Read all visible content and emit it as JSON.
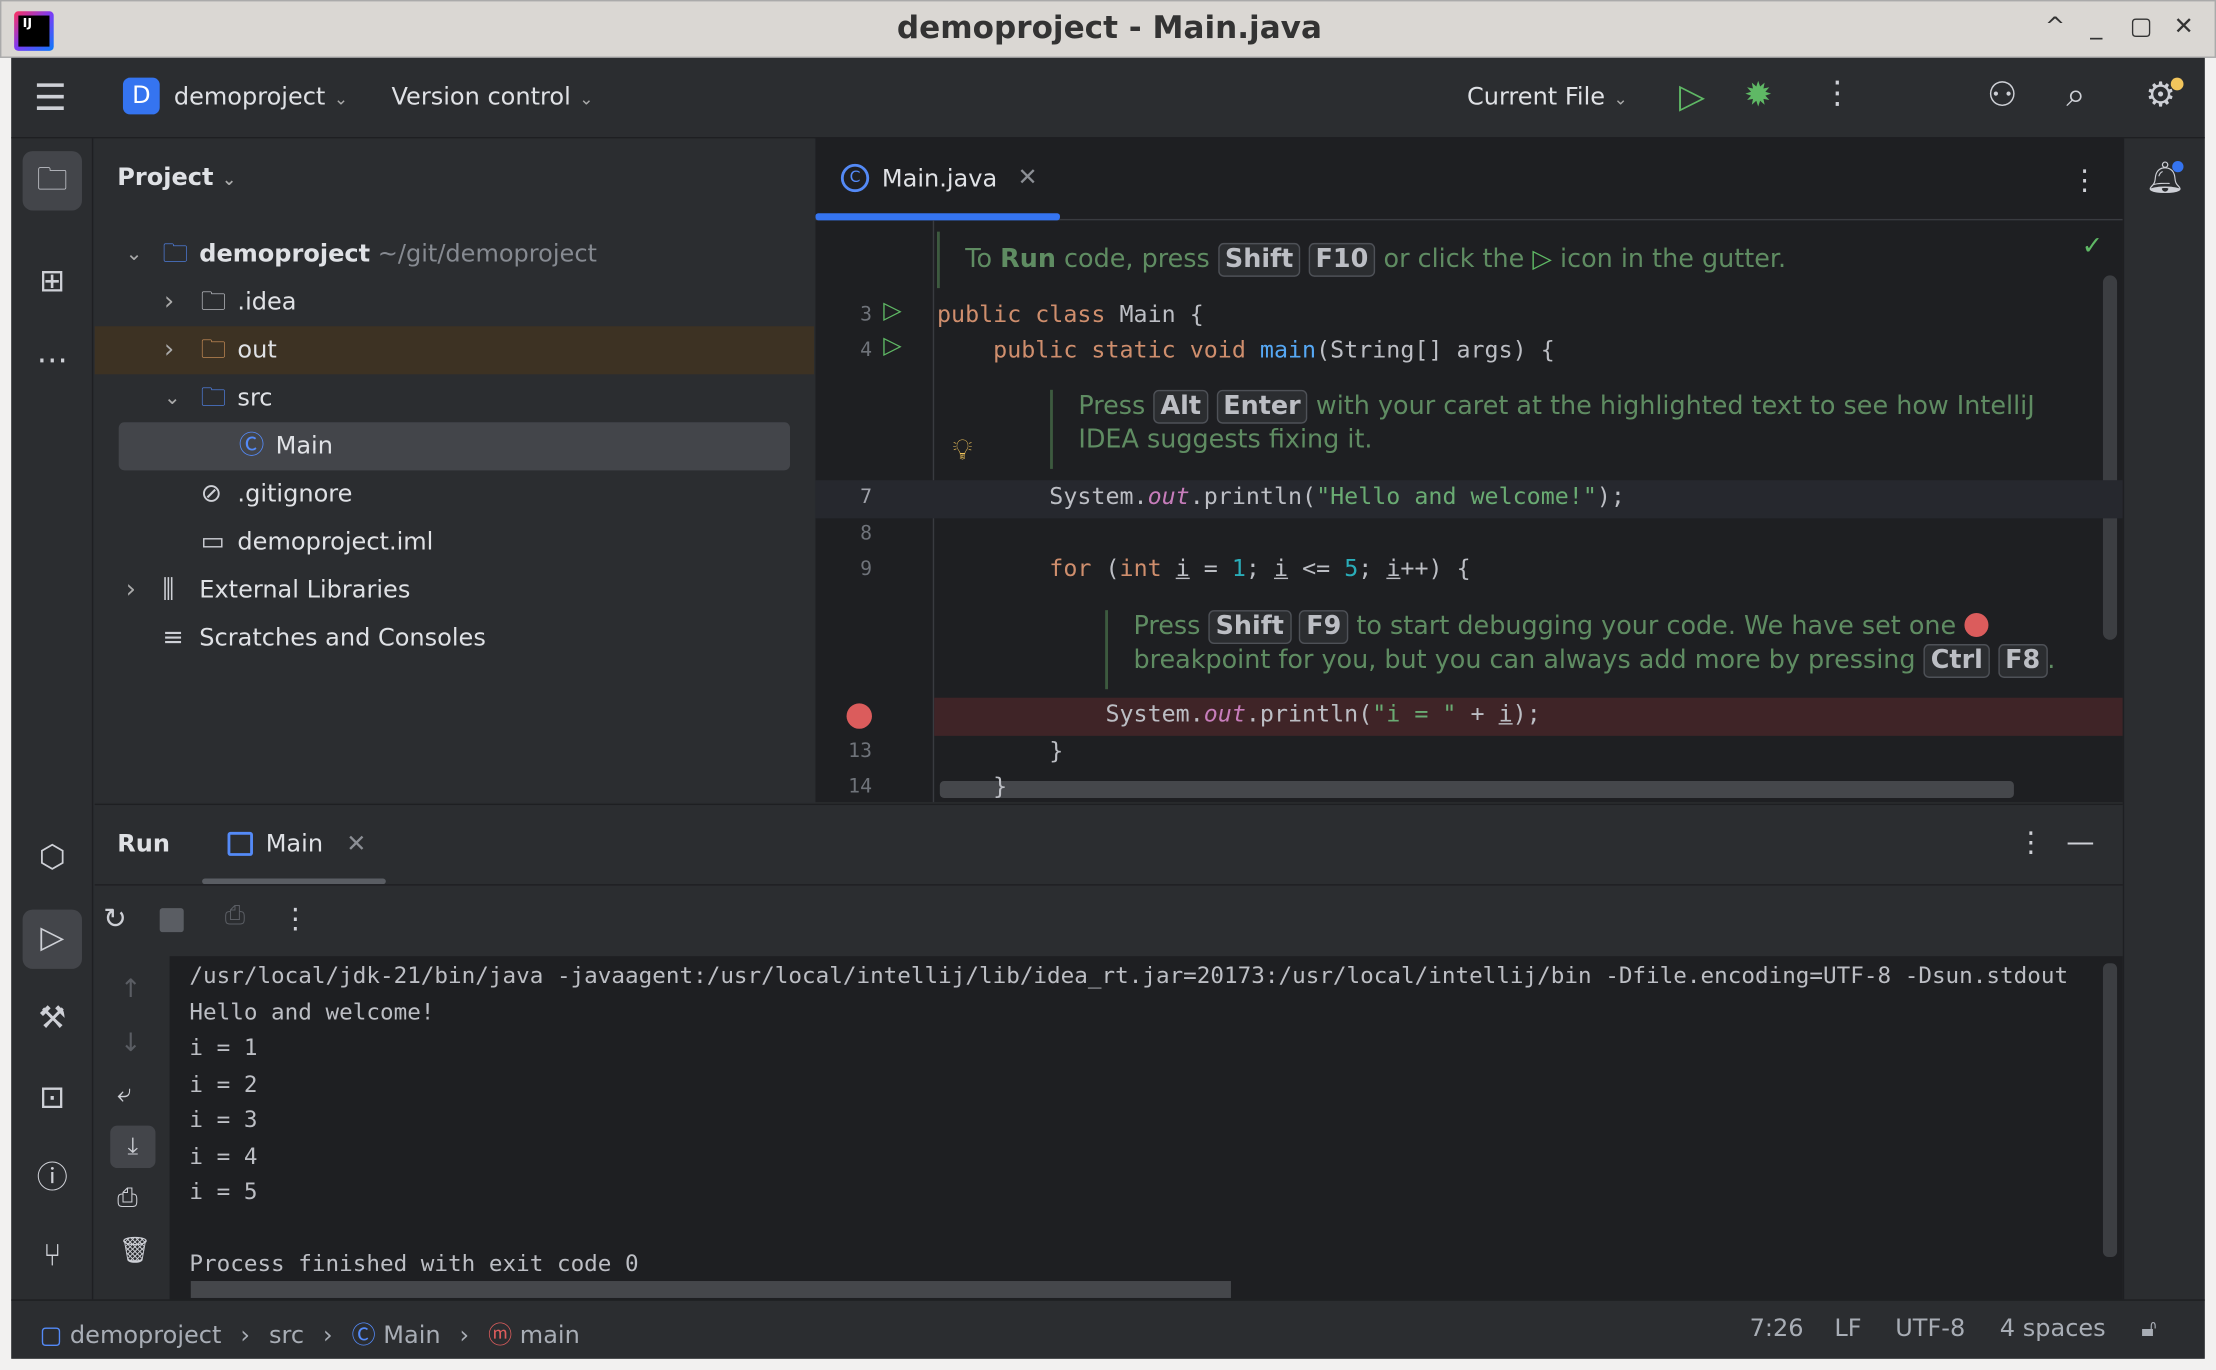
{
  "window": {
    "title": "demoproject - Main.java",
    "controls": [
      "^",
      "_",
      "▢",
      "✕"
    ]
  },
  "toolbar": {
    "project_badge": "D",
    "project": "demoproject",
    "vcs": "Version control",
    "run_config": "Current File"
  },
  "project_panel": {
    "title": "Project",
    "tree": [
      {
        "label": "demoproject",
        "hint": "~/git/demoproject",
        "icon": "module-folder-icon",
        "level": 0,
        "expanded": true,
        "bold": true
      },
      {
        "label": ".idea",
        "icon": "folder-icon",
        "level": 1,
        "expanded": false
      },
      {
        "label": "out",
        "icon": "folder-icon",
        "level": 1,
        "expanded": false,
        "excluded": true
      },
      {
        "label": "src",
        "icon": "source-folder-icon",
        "level": 1,
        "expanded": true
      },
      {
        "label": "Main",
        "icon": "class-icon",
        "level": 2,
        "selected": true
      },
      {
        "label": ".gitignore",
        "icon": "ignore-file-icon",
        "level": 1
      },
      {
        "label": "demoproject.iml",
        "icon": "iml-file-icon",
        "level": 1
      },
      {
        "label": "External Libraries",
        "icon": "library-icon",
        "level": 0,
        "expanded": false
      },
      {
        "label": "Scratches and Consoles",
        "icon": "scratches-icon",
        "level": 0
      }
    ]
  },
  "editor": {
    "tab": "Main.java",
    "tip_run": {
      "pre": "To ",
      "bold": "Run",
      "mid": " code, press ",
      "k1": "Shift",
      "k2": "F10",
      "post1": " or click the ",
      "post2": " icon in the gutter."
    },
    "tip_fix": {
      "pre": "Press ",
      "k1": "Alt",
      "k2": "Enter",
      "post": " with your caret at the highlighted text to see how IntelliJ IDEA suggests fixing it."
    },
    "tip_debug": {
      "pre": "Press ",
      "k1": "Shift",
      "k2": "F9",
      "mid": " to start debugging your code. We have set one ",
      "line2": "breakpoint for you, but you can always add more by pressing ",
      "k3": "Ctrl",
      "k4": "F8",
      "end": "."
    },
    "lines": [
      {
        "n": "3",
        "tokens": [
          [
            "kw",
            "public class "
          ],
          [
            "",
            "Main {"
          ]
        ]
      },
      {
        "n": "4",
        "tokens": [
          [
            "kw",
            "    public static void "
          ],
          [
            "fn",
            "main"
          ],
          [
            "",
            "(String[] args) {"
          ]
        ]
      },
      {
        "n": "7",
        "tokens": [
          [
            "",
            "        System."
          ],
          [
            "it",
            "out"
          ],
          [
            "",
            ".println("
          ],
          [
            "st",
            "\"Hello and welcome!\""
          ],
          [
            "",
            ");"
          ]
        ]
      },
      {
        "n": "8",
        "tokens": []
      },
      {
        "n": "9",
        "tokens": [
          [
            "kw",
            "        for "
          ],
          [
            "",
            "("
          ],
          [
            "kw",
            "int "
          ],
          [
            "ul",
            "i"
          ],
          [
            "",
            " = "
          ],
          [
            "nm",
            "1"
          ],
          [
            "",
            "; "
          ],
          [
            "ul",
            "i"
          ],
          [
            "",
            " <= "
          ],
          [
            "nm",
            "5"
          ],
          [
            "",
            "; "
          ],
          [
            "ul",
            "i"
          ],
          [
            "",
            "++) {"
          ]
        ]
      },
      {
        "n": "",
        "tokens": [
          [
            "",
            "            System."
          ],
          [
            "it",
            "out"
          ],
          [
            "",
            ".println("
          ],
          [
            "st",
            "\"i = \""
          ],
          [
            "",
            " + "
          ],
          [
            "ul",
            "i"
          ],
          [
            "",
            ");"
          ]
        ]
      },
      {
        "n": "13",
        "tokens": [
          [
            "",
            "        }"
          ]
        ]
      },
      {
        "n": "14",
        "tokens": [
          [
            "",
            "    }"
          ]
        ]
      }
    ]
  },
  "run_panel": {
    "title": "Run",
    "tab": "Main",
    "console": [
      "/usr/local/jdk-21/bin/java -javaagent:/usr/local/intellij/lib/idea_rt.jar=20173:/usr/local/intellij/bin -Dfile.encoding=UTF-8 -Dsun.stdout",
      "Hello and welcome!",
      "i = 1",
      "i = 2",
      "i = 3",
      "i = 4",
      "i = 5",
      "",
      "Process finished with exit code 0"
    ]
  },
  "status": {
    "breadcrumbs": [
      "demoproject",
      "src",
      "Main",
      "main"
    ],
    "position": "7:26",
    "line_sep": "LF",
    "encoding": "UTF-8",
    "indent": "4 spaces"
  },
  "colors": {
    "accent": "#3574f0",
    "run_green": "#5fb865",
    "breakpoint": "#db5c5c",
    "tip_text": "#5f8c62"
  }
}
